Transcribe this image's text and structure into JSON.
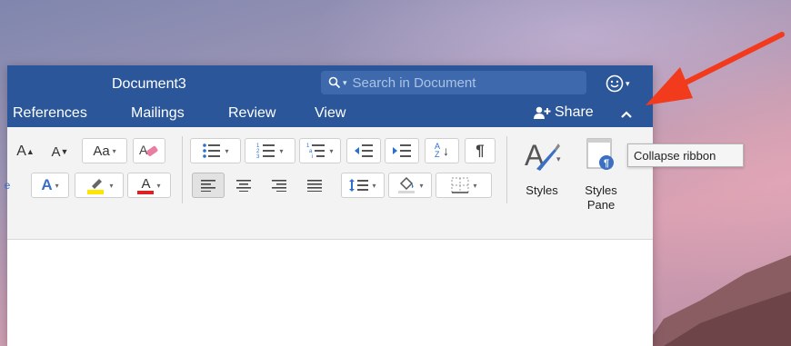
{
  "window": {
    "title": "Document3"
  },
  "search": {
    "placeholder": "Search in Document"
  },
  "tabs": [
    {
      "label": "References"
    },
    {
      "label": "Mailings"
    },
    {
      "label": "Review"
    },
    {
      "label": "View"
    }
  ],
  "share": {
    "label": "Share"
  },
  "ribbon": {
    "styles_label": "Styles",
    "styles_pane_label_1": "Styles",
    "styles_pane_label_2": "Pane",
    "sort_letters_top": "A",
    "sort_letters_bottom": "Z",
    "font_color_letter": "A",
    "text_effects_letter": "A",
    "grow_font_letter": "A",
    "shrink_font_letter": "A",
    "change_case_letters": "Aa",
    "paragraph_mark": "¶"
  },
  "tooltip": {
    "text": "Collapse ribbon"
  },
  "colors": {
    "title_bar": "#2b579a",
    "highlight": "#ffe600",
    "font_color": "#e02020",
    "annotation_arrow": "#f23a1d"
  },
  "icons": [
    "search-icon",
    "smiley-feedback-icon",
    "share-person-icon",
    "chevron-up-icon",
    "grow-font-icon",
    "shrink-font-icon",
    "change-case-icon",
    "clear-formatting-icon",
    "bullets-icon",
    "numbering-icon",
    "multilevel-list-icon",
    "decrease-indent-icon",
    "increase-indent-icon",
    "sort-icon",
    "paragraph-mark-icon",
    "text-effects-icon",
    "highlight-icon",
    "font-color-icon",
    "align-left-icon",
    "align-center-icon",
    "align-right-icon",
    "justify-icon",
    "line-spacing-icon",
    "shading-icon",
    "borders-icon",
    "styles-icon",
    "styles-pane-icon"
  ]
}
